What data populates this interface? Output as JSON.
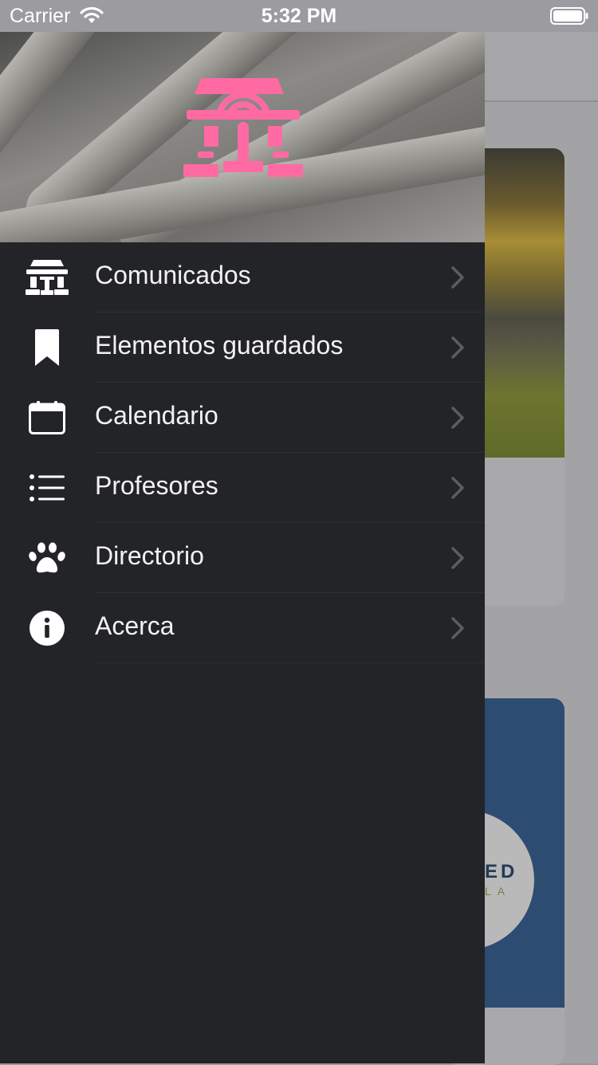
{
  "status_bar": {
    "carrier": "Carrier",
    "time": "5:32 PM"
  },
  "drawer": {
    "menu": [
      {
        "label": "Comunicados",
        "icon": "temple-icon"
      },
      {
        "label": "Elementos guardados",
        "icon": "bookmark-icon"
      },
      {
        "label": "Calendario",
        "icon": "calendar-icon"
      },
      {
        "label": "Profesores",
        "icon": "list-icon"
      },
      {
        "label": "Directorio",
        "icon": "paw-icon"
      },
      {
        "label": "Acerca",
        "icon": "info-icon"
      }
    ]
  },
  "background": {
    "card2_logo_text": "ED",
    "card2_logo_sub": "LA"
  },
  "colors": {
    "drawer_bg": "#232428",
    "logo_pink": "#ff6aa3",
    "card_blue": "#2d4c71"
  }
}
